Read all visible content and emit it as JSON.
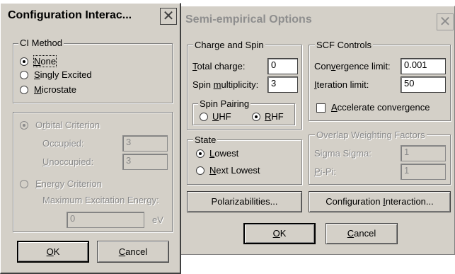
{
  "semi_dialog": {
    "title": "Semi-empirical Options",
    "charge_spin": {
      "legend": "Charge and Spin",
      "total_charge_label": "Total charge:",
      "total_charge_value": "0",
      "spin_mult_label": "Spin multiplicity:",
      "spin_mult_value": "3",
      "spin_pairing": {
        "legend": "Spin Pairing",
        "uhf": "UHF",
        "rhf": "RHF",
        "selected": "RHF"
      }
    },
    "scf": {
      "legend": "SCF Controls",
      "conv_label": "Convergence limit:",
      "conv_value": "0.001",
      "iter_label": "Iteration limit:",
      "iter_value": "50",
      "accel_label": "Accelerate convergence",
      "accel_checked": false
    },
    "state": {
      "legend": "State",
      "lowest": "Lowest",
      "next_lowest": "Next Lowest",
      "selected": "Lowest"
    },
    "overlap": {
      "legend": "Overlap Weighting Factors",
      "sigma_label": "Sigma Sigma:",
      "sigma_value": "1",
      "pipi_label": "Pi-Pi:",
      "pipi_value": "1"
    },
    "buttons": {
      "polarizabilities": "Polarizabilities...",
      "config_interaction": "Configuration Interaction...",
      "ok": "OK",
      "cancel": "Cancel"
    }
  },
  "ci_dialog": {
    "title": "Configuration Interac...",
    "ci_method": {
      "legend": "CI Method",
      "none": "None",
      "singly_excited": "Singly Excited",
      "microstate": "Microstate",
      "selected": "None"
    },
    "orbital_criterion": {
      "label": "Orbital Criterion",
      "occupied_label": "Occupied:",
      "occupied_value": "3",
      "unoccupied_label": "Unoccupied:",
      "unoccupied_value": "3"
    },
    "energy_criterion": {
      "label": "Energy Criterion",
      "max_excitation_label": "Maximum Excitation Energy:",
      "max_excitation_value": "0",
      "unit": "eV"
    },
    "buttons": {
      "ok": "OK",
      "cancel": "Cancel"
    }
  },
  "colors": {
    "dialog_face": "#d4d0c8",
    "semi_title_text": "#8e8e8e",
    "disabled_text": "#8a8a8a"
  }
}
